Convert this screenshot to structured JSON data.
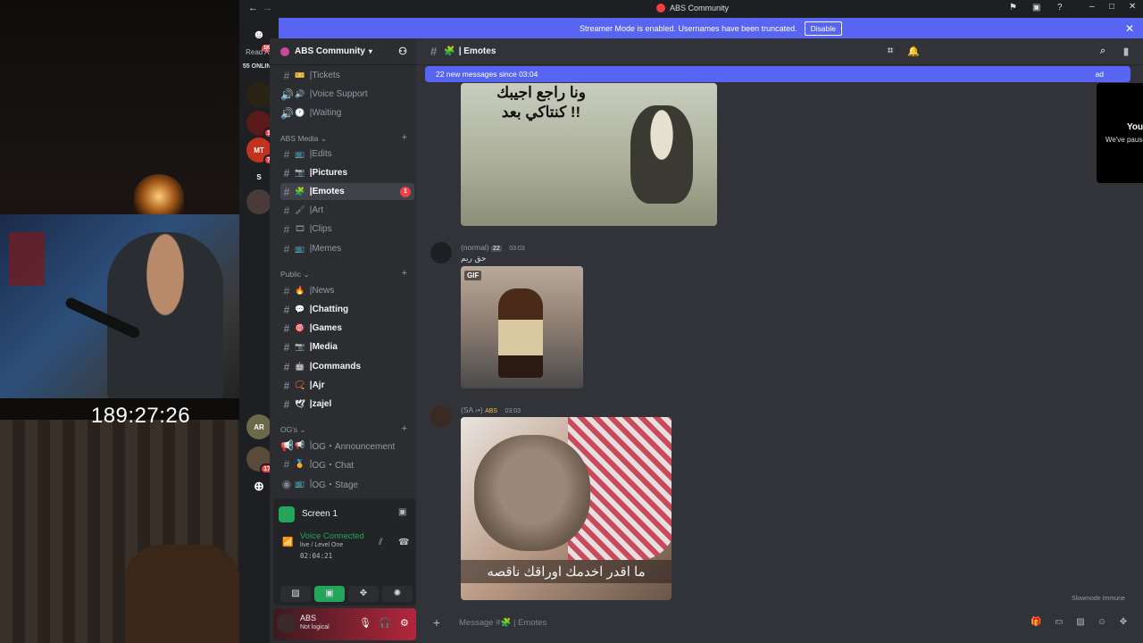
{
  "stream": {
    "timer": "189:27:26"
  },
  "titlebar": {
    "title": "ABS Community"
  },
  "guilds": {
    "read_all": "Read All",
    "online": "55 ONLINE",
    "logo_badge": "1K+",
    "servers": [
      {
        "label": "",
        "badge": ""
      },
      {
        "label": "",
        "badge": "1"
      },
      {
        "label": "MT",
        "badge": "7"
      },
      {
        "label": "S",
        "badge": ""
      },
      {
        "label": "",
        "badge": ""
      },
      {
        "label": "AR",
        "badge": ""
      },
      {
        "label": "",
        "badge": "17"
      }
    ]
  },
  "banner": {
    "text": "Streamer Mode is enabled. Usernames have been truncated.",
    "disable": "Disable"
  },
  "server": {
    "name": "ABS Community"
  },
  "channels": {
    "top": [
      {
        "emoji": "🎫",
        "name": "Tickets"
      },
      {
        "emoji": "🔊",
        "name": "Voice Support"
      },
      {
        "emoji": "🕐",
        "name": "Waiting"
      }
    ],
    "media_cat": "ABS Media",
    "media": [
      {
        "emoji": "📺",
        "name": "Edits"
      },
      {
        "emoji": "📷",
        "name": "Pictures"
      },
      {
        "emoji": "🧩",
        "name": "Emotes",
        "badge": "1"
      },
      {
        "emoji": "🖌",
        "name": "Art"
      },
      {
        "emoji": "🎞",
        "name": "Clips"
      },
      {
        "emoji": "📺",
        "name": "Memes"
      }
    ],
    "public_cat": "Public",
    "public": [
      {
        "emoji": "🔥",
        "name": "News"
      },
      {
        "emoji": "💬",
        "name": "Chatting"
      },
      {
        "emoji": "🎯",
        "name": "Games"
      },
      {
        "emoji": "📷",
        "name": "Media"
      },
      {
        "emoji": "🤖",
        "name": "Commands"
      },
      {
        "emoji": "📿",
        "name": "Ajr"
      },
      {
        "emoji": "🕊",
        "name": "zajel"
      }
    ],
    "og_cat": "OG's",
    "og": [
      {
        "emoji": "📢",
        "name": "OG・Announcement"
      },
      {
        "emoji": "🏅",
        "name": "OG・Chat"
      },
      {
        "emoji": "📺",
        "name": "OG・Stage"
      }
    ]
  },
  "voice": {
    "screen": "Screen 1",
    "status": "Voice Connected",
    "detail": "live / Level One",
    "time": "02:04:21"
  },
  "user": {
    "name": "ABS",
    "status": "Not logical"
  },
  "chat": {
    "channel": "Emotes",
    "new_messages": "22 new messages since 03:04",
    "popup_title": "Your stream is still running!",
    "popup_body": "We've paused this preview to save your resources.",
    "msg1_caption": "ونا راجع اجيبك كنتاكي بعد !!",
    "msg2_name": "(normal)",
    "msg2_tag": "22",
    "msg2_time": "03:03",
    "msg2_text": "حق ريم",
    "gif_label": "GIF",
    "msg3_name": "(SA ‹•)",
    "msg3_tag": "ABS",
    "msg3_time": "03:03",
    "msg3_caption": "ما اقدر اخدمك اوراقك ناقصه",
    "slowmode": "Slowmode Immune",
    "compose_placeholder": "Message #🧩 | Emotes"
  },
  "colors": {
    "accent": "#5865f2",
    "danger": "#f23f43",
    "green": "#23a55a"
  }
}
